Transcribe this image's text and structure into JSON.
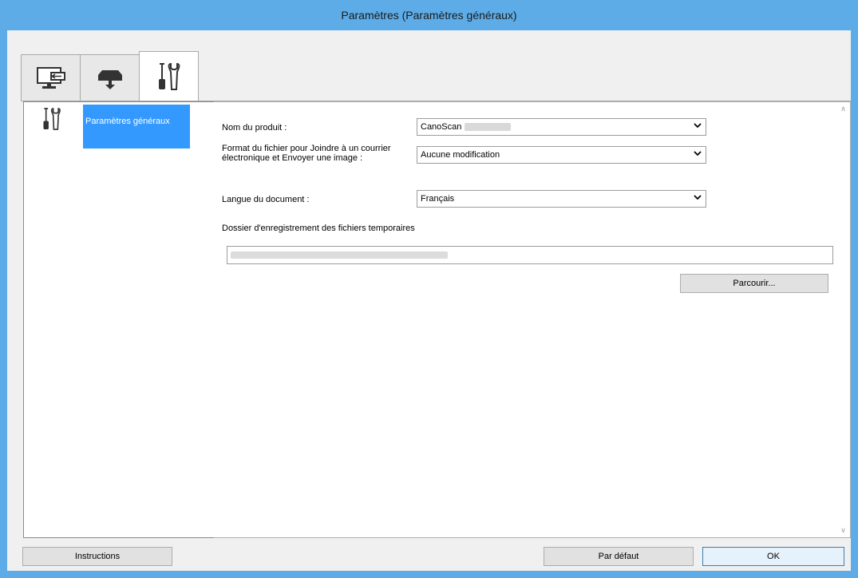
{
  "window": {
    "title": "Paramètres (Paramètres généraux)"
  },
  "tabs": [
    {
      "icon": "scan-to-computer-icon",
      "active": false
    },
    {
      "icon": "scanner-icon",
      "active": false
    },
    {
      "icon": "tools-icon",
      "active": true
    }
  ],
  "sidebar": {
    "items": [
      {
        "icon": "tools-icon",
        "label": "Paramètres généraux",
        "selected": true
      }
    ]
  },
  "settings": {
    "product_name_label": "Nom du produit :",
    "product_name_value": "CanoScan",
    "file_format_label": "Format du fichier pour Joindre à un courrier électronique et Envoyer une image :",
    "file_format_value": "Aucune modification",
    "doc_language_label": "Langue du document :",
    "doc_language_value": "Français",
    "temp_folder_label": "Dossier d'enregistrement des fichiers temporaires",
    "browse_label": "Parcourir..."
  },
  "footer": {
    "instructions_label": "Instructions",
    "defaults_label": "Par défaut",
    "ok_label": "OK"
  },
  "colors": {
    "titlebar": "#5dace8",
    "selection": "#3399ff"
  }
}
